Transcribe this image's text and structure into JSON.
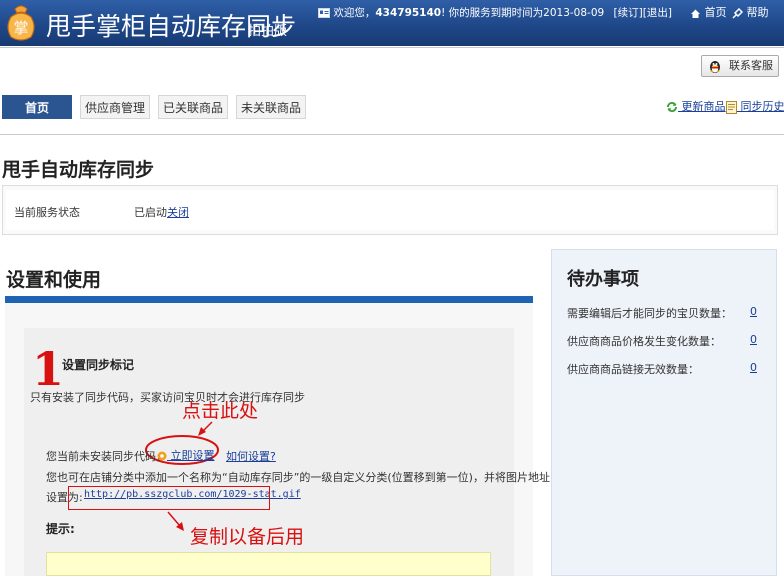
{
  "header": {
    "logo_char": "掌",
    "app_title": "甩手掌柜自动库存同步",
    "edition": "拍拍版",
    "welcome_prefix": "欢迎您，",
    "user_id": "434795140",
    "service_text": "! 你的服务到期时间为2013-08-09",
    "renew_label": "[续订]",
    "logout_label": "[退出]",
    "home_label": "首页",
    "help_label": "帮助"
  },
  "toolbar": {
    "contact_label": "联系客服"
  },
  "nav": {
    "tabs": [
      {
        "label": "首页",
        "active": true
      },
      {
        "label": "供应商管理",
        "active": false
      },
      {
        "label": "已关联商品",
        "active": false
      },
      {
        "label": "未关联商品",
        "active": false
      }
    ],
    "update_goods": "更新商品",
    "sync_history": "同步历史"
  },
  "page": {
    "title": "甩手自动库存同步",
    "status_label": "当前服务状态",
    "status_value": "已启动",
    "status_action": "关闭"
  },
  "setup": {
    "title": "设置和使用",
    "step_number": "1",
    "step_title": "设置同步标记",
    "step_desc": "只有安装了同步代码，买家访问宝贝时才会进行库存同步",
    "annotation_click": "点击此处",
    "not_installed_text": "您当前未安装同步代码，",
    "setup_now": "立即设置",
    "how_to_setup": "如何设置?",
    "also_text": "您也可在店铺分类中添加一个名称为“自动库存同步”的一级自定义分类(位置移到第一位)，并将图片地址",
    "address_label": "设置为:",
    "address_url": "http://pb.sszgclub.com/1029-stat.gif",
    "annotation_copy": "复制以备后用",
    "tip_label": "提示:"
  },
  "todo": {
    "title": "待办事项",
    "items": [
      {
        "label": "需要编辑后才能同步的宝贝数量：",
        "count": "0"
      },
      {
        "label": "供应商商品价格发生变化数量：",
        "count": "0"
      },
      {
        "label": "供应商商品链接无效数量：",
        "count": "0"
      }
    ]
  },
  "colors": {
    "header_blue": "#1e4687",
    "active_tab": "#2b5591",
    "link_blue": "#1a3f9a",
    "annotation_red": "#d81010",
    "setup_bar": "#1f63b5"
  }
}
